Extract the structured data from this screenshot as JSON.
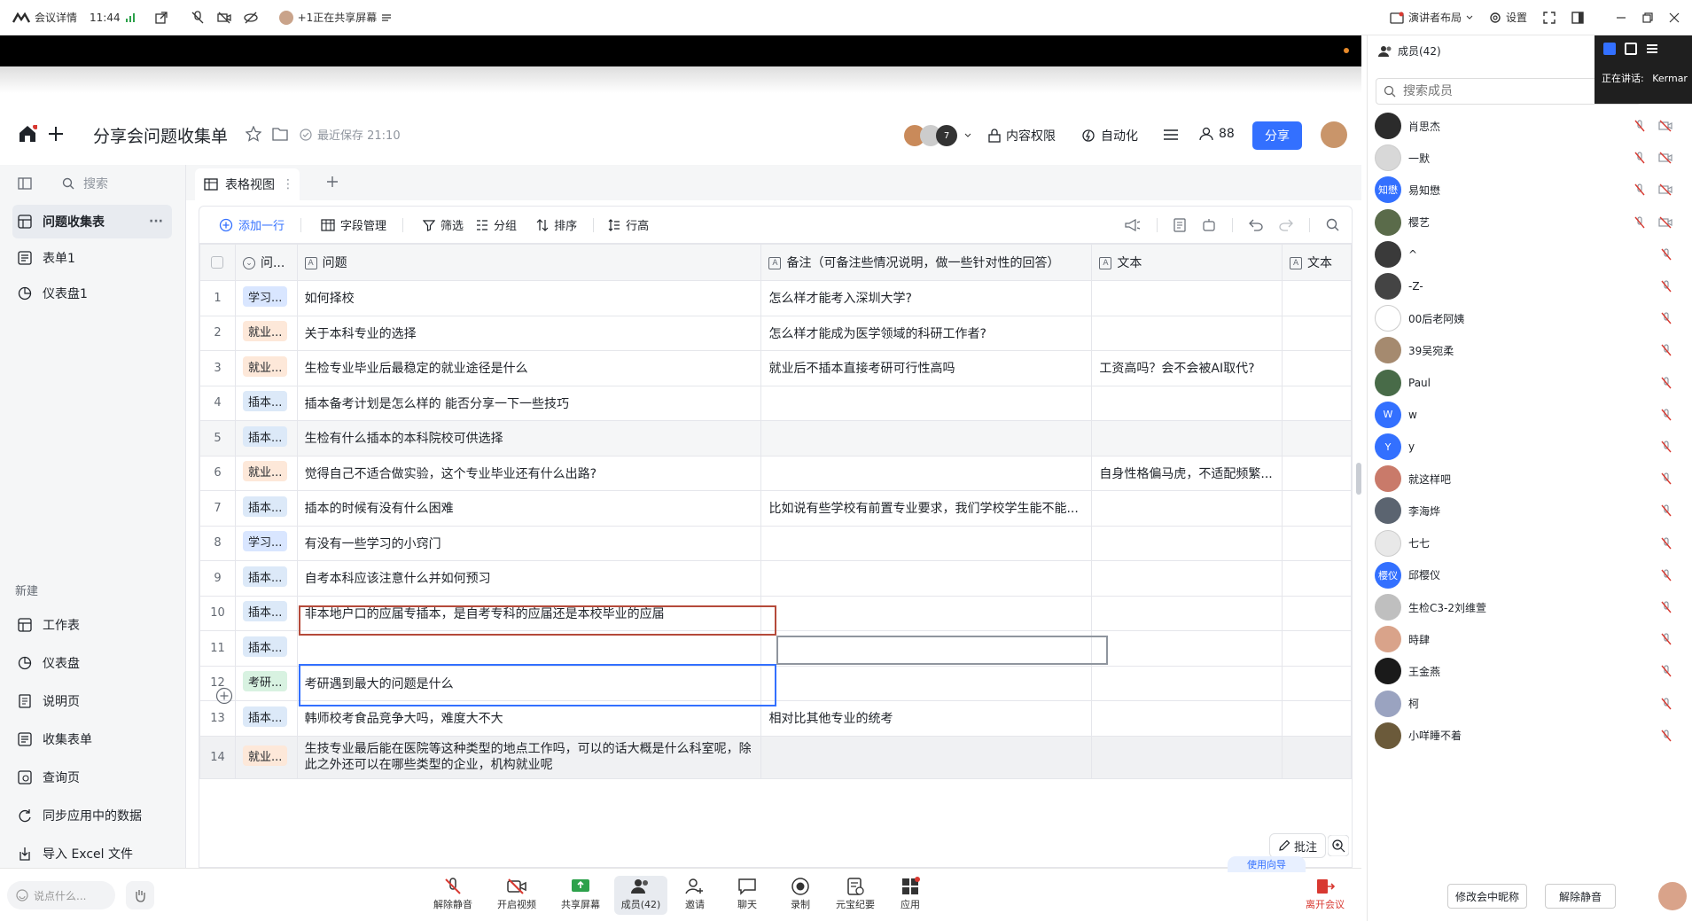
{
  "meeting_bar": {
    "details": "会议详情",
    "time": "11:44",
    "sharing": "+1正在共享屏幕",
    "speaker_layout": "演讲者布局",
    "settings": "设置"
  },
  "app": {
    "title": "分享会问题收集单",
    "last_saved": "最近保存 21:10",
    "content_permission": "内容权限",
    "automation": "自动化",
    "collaborators": "88",
    "share": "分享",
    "avatar_badge": "7"
  },
  "sidebar": {
    "search": "搜索",
    "items": [
      {
        "label": "问题收集表"
      },
      {
        "label": "表单1"
      },
      {
        "label": "仪表盘1"
      }
    ],
    "new_label": "新建",
    "new_items": [
      {
        "label": "工作表"
      },
      {
        "label": "仪表盘"
      },
      {
        "label": "说明页"
      },
      {
        "label": "收集表单"
      },
      {
        "label": "查询页"
      },
      {
        "label": "同步应用中的数据"
      },
      {
        "label": "导入 Excel 文件"
      }
    ]
  },
  "tabs": {
    "grid_view": "表格视图"
  },
  "toolbar": {
    "add_row": "添加一行",
    "field_manage": "字段管理",
    "filter": "筛选",
    "group": "分组",
    "sort": "排序",
    "row_height": "行高"
  },
  "grid": {
    "columns": [
      "问...",
      "问题",
      "备注（可备注些情况说明，做一些针对性的回答）",
      "文本",
      "文本"
    ],
    "rows": [
      {
        "n": "1",
        "tag": "学习...",
        "tagc": "study",
        "q": "如何择校",
        "note": "怎么样才能考入深圳大学?",
        "text": ""
      },
      {
        "n": "2",
        "tag": "就业...",
        "tagc": "job",
        "q": "关于本科专业的选择",
        "note": "怎么样才能成为医学领域的科研工作者?",
        "text": ""
      },
      {
        "n": "3",
        "tag": "就业...",
        "tagc": "job",
        "q": "生检专业毕业后最稳定的就业途径是什么",
        "note": "就业后不插本直接考研可行性高吗",
        "text": "工资高吗？会不会被AI取代?"
      },
      {
        "n": "4",
        "tag": "插本...",
        "tagc": "cha",
        "q": "插本备考计划是怎么样的 能否分享一下一些技巧",
        "note": "",
        "text": ""
      },
      {
        "n": "5",
        "tag": "插本...",
        "tagc": "cha",
        "q": "生检有什么插本的本科院校可供选择",
        "note": "",
        "text": ""
      },
      {
        "n": "6",
        "tag": "就业...",
        "tagc": "job",
        "q": "觉得自己不适合做实验，这个专业毕业还有什么出路?",
        "note": "",
        "text": "自身性格偏马虎，不适配频繁..."
      },
      {
        "n": "7",
        "tag": "插本...",
        "tagc": "cha",
        "q": "插本的时候有没有什么困难",
        "note": "比如说有些学校有前置专业要求，我们学校学生能不能...",
        "text": ""
      },
      {
        "n": "8",
        "tag": "学习...",
        "tagc": "study",
        "q": "有没有一些学习的小窍门",
        "note": "",
        "text": ""
      },
      {
        "n": "9",
        "tag": "插本...",
        "tagc": "cha",
        "q": "自考本科应该注意什么并如何预习",
        "note": "",
        "text": ""
      },
      {
        "n": "10",
        "tag": "插本...",
        "tagc": "cha",
        "q": "非本地户口的应届专插本，是自考专科的应届还是本校毕业的应届",
        "note": "",
        "text": ""
      },
      {
        "n": "11",
        "tag": "插本...",
        "tagc": "cha",
        "q": "",
        "note": "",
        "text": ""
      },
      {
        "n": "12",
        "tag": "考研...",
        "tagc": "kao",
        "q": "考研遇到最大的问题是什么",
        "note": "",
        "text": ""
      },
      {
        "n": "13",
        "tag": "插本...",
        "tagc": "cha",
        "q": "韩师校考食品竞争大吗，难度大不大",
        "note": "相对比其他专业的统考",
        "text": ""
      },
      {
        "n": "14",
        "tag": "就业...",
        "tagc": "job",
        "q": "生技专业最后能在医院等这种类型的地点工作吗，可以的话大概是什么科室呢，除此之外还可以在哪些类型的企业，机构就业呢",
        "note": "",
        "text": ""
      }
    ]
  },
  "annotate": "批注",
  "members_panel": {
    "title": "成员(42)",
    "search_placeholder": "搜索成员",
    "speaking": "正在讲话:",
    "speaker_name": "Kermar",
    "members": [
      {
        "name": "肖思杰",
        "avatar": "",
        "color": "#2b2b2b",
        "cam": true
      },
      {
        "name": "一默",
        "avatar": "",
        "color": "#d8d8d8",
        "cam": true
      },
      {
        "name": "易知懋",
        "avatar": "知懋",
        "color": "#3370ff",
        "cam": true
      },
      {
        "name": "樱艺",
        "avatar": "",
        "color": "#5a6b4a",
        "cam": true
      },
      {
        "name": "^",
        "avatar": "",
        "color": "#3a3a3a",
        "cam": false
      },
      {
        "name": "-Z-",
        "avatar": "",
        "color": "#444444",
        "cam": false
      },
      {
        "name": "00后老阿姨",
        "avatar": "",
        "color": "#ffffff",
        "cam": false
      },
      {
        "name": "39吴宛柔",
        "avatar": "",
        "color": "#a58a6f",
        "cam": false
      },
      {
        "name": "Paul",
        "avatar": "",
        "color": "#486b48",
        "cam": false
      },
      {
        "name": "w",
        "avatar": "W",
        "color": "#3370ff",
        "cam": false
      },
      {
        "name": "y",
        "avatar": "Y",
        "color": "#3370ff",
        "cam": false
      },
      {
        "name": "就这样吧",
        "avatar": "",
        "color": "#c97a6a",
        "cam": false
      },
      {
        "name": "李海烨",
        "avatar": "",
        "color": "#5b6470",
        "cam": false
      },
      {
        "name": "七七",
        "avatar": "",
        "color": "#e8e8e8",
        "cam": false
      },
      {
        "name": "邱樱仪",
        "avatar": "樱仪",
        "color": "#3370ff",
        "cam": false
      },
      {
        "name": "生检C3-2刘维萱",
        "avatar": "",
        "color": "#bfbfbf",
        "cam": false
      },
      {
        "name": "時肆",
        "avatar": "",
        "color": "#d9a38a",
        "cam": false
      },
      {
        "name": "王金燕",
        "avatar": "",
        "color": "#1a1a1a",
        "cam": false
      },
      {
        "name": "柯",
        "avatar": "",
        "color": "#9aa3c0",
        "cam": false
      },
      {
        "name": "小咩睡不着",
        "avatar": "",
        "color": "#6b5a3a",
        "cam": false
      }
    ],
    "rename_btn": "修改会中昵称",
    "unmute_btn": "解除静音"
  },
  "bottom_bar": {
    "chat_placeholder": "说点什么...",
    "unmute": "解除静音",
    "start_video": "开启视频",
    "share_screen": "共享屏幕",
    "members": "成员(42)",
    "invite": "邀请",
    "chat": "聊天",
    "record": "录制",
    "minutes": "元宝纪要",
    "apps": "应用",
    "leave": "离开会议",
    "peek": "使用向导"
  },
  "colors": {
    "accent": "#3370ff",
    "danger": "#d83931",
    "active_cell": "#3370ff",
    "red_cell": "#b54a3a"
  }
}
